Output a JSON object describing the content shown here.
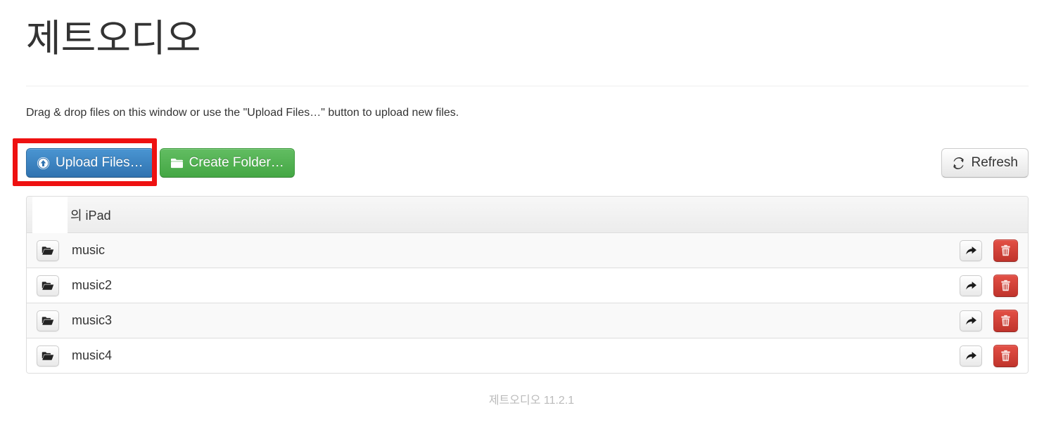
{
  "app": {
    "title": "제트오디오",
    "intro": "Drag & drop files on this window or use the \"Upload Files…\" button to upload new files.",
    "footer": "제트오디오 11.2.1"
  },
  "toolbar": {
    "upload_label": "Upload Files…",
    "upload_icon": "circle-arrow-up-icon",
    "create_folder_label": "Create Folder…",
    "create_folder_icon": "folder-icon",
    "refresh_label": "Refresh",
    "refresh_icon": "refresh-icon"
  },
  "annotation": {
    "target": "upload-files-button",
    "color": "#ee1111"
  },
  "file_list": {
    "header": {
      "name": "의 iPad",
      "redacted": true
    },
    "rows": [
      {
        "name": "music",
        "icon": "folder-open-icon",
        "share_icon": "share-arrow-icon",
        "delete_icon": "trash-icon"
      },
      {
        "name": "music2",
        "icon": "folder-open-icon",
        "share_icon": "share-arrow-icon",
        "delete_icon": "trash-icon"
      },
      {
        "name": "music3",
        "icon": "folder-open-icon",
        "share_icon": "share-arrow-icon",
        "delete_icon": "trash-icon"
      },
      {
        "name": "music4",
        "icon": "folder-open-icon",
        "share_icon": "share-arrow-icon",
        "delete_icon": "trash-icon"
      }
    ]
  },
  "colors": {
    "primary": "#3073b0",
    "success": "#44a744",
    "danger": "#c0342c",
    "annotation": "#ee1111"
  }
}
